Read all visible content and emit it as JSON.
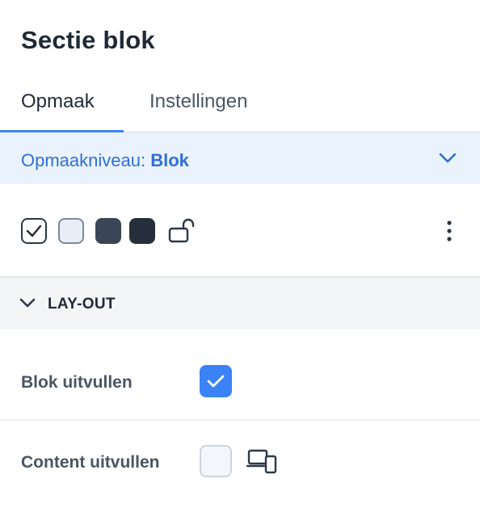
{
  "panel": {
    "title": "Sectie blok"
  },
  "tabs": [
    {
      "label": "Opmaak",
      "active": true
    },
    {
      "label": "Instellingen",
      "active": false
    }
  ],
  "level": {
    "prefix": "Opmaakniveau:",
    "value": "Blok"
  },
  "swatches": [
    {
      "name": "white",
      "color": "#ffffff",
      "selected": true
    },
    {
      "name": "light",
      "color": "#e8eef7",
      "selected": false
    },
    {
      "name": "dark",
      "color": "#3a4656",
      "selected": false
    },
    {
      "name": "darker",
      "color": "#252e3a",
      "selected": false
    }
  ],
  "layout_section": {
    "label": "LAY-OUT",
    "rows": [
      {
        "label": "Blok uitvullen",
        "checked": true
      },
      {
        "label": "Content uitvullen",
        "checked": false
      }
    ]
  },
  "colors": {
    "accent": "#3b82f6",
    "level_bg": "#eaf3fd",
    "text": "#1f2a37"
  }
}
